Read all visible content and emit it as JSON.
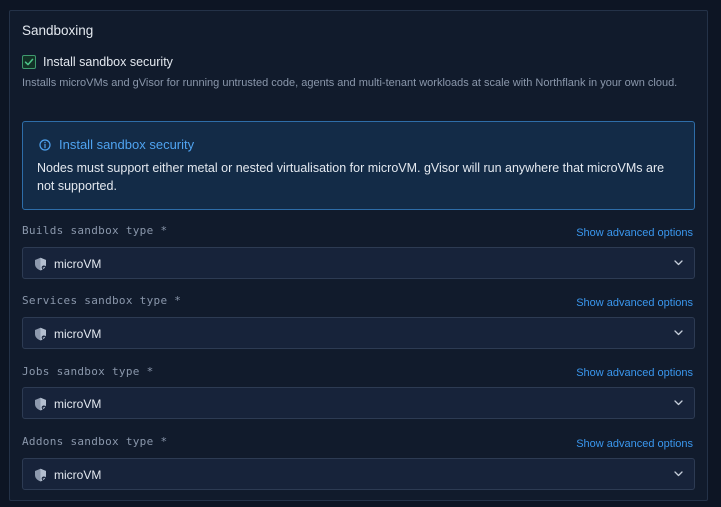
{
  "section": {
    "title": "Sandboxing",
    "checkbox_label": "Install sandbox security",
    "checked": true,
    "help_text": "Installs microVMs and gVisor for running untrusted code, agents and multi-tenant workloads at scale with Northflank in your own cloud."
  },
  "callout": {
    "icon": "info-icon",
    "title": "Install sandbox security",
    "body": "Nodes must support either metal or nested virtualisation for microVM. gVisor will run anywhere that microVMs are not supported."
  },
  "fields": [
    {
      "label": "Builds sandbox type *",
      "link": "Show advanced options",
      "value": "microVM",
      "icon": "shield-icon"
    },
    {
      "label": "Services sandbox type *",
      "link": "Show advanced options",
      "value": "microVM",
      "icon": "shield-icon"
    },
    {
      "label": "Jobs sandbox type *",
      "link": "Show advanced options",
      "value": "microVM",
      "icon": "shield-icon"
    },
    {
      "label": "Addons sandbox type *",
      "link": "Show advanced options",
      "value": "microVM",
      "icon": "shield-icon"
    }
  ],
  "colors": {
    "background": "#0d1524",
    "panel": "#111b2c",
    "accent": "#3a97ee",
    "callout_border": "#2e6da8",
    "checkbox_green": "#3f9a6e"
  }
}
